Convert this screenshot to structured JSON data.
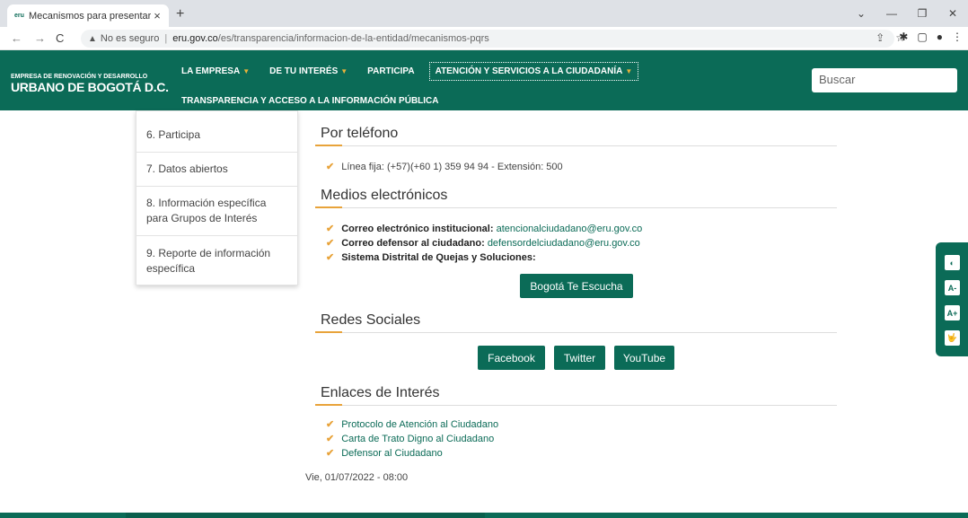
{
  "browser": {
    "tab_title": "Mecanismos para presentar Petic",
    "favicon_text": "eru",
    "back": "←",
    "forward": "→",
    "reload": "C",
    "security_text": "No es seguro",
    "url_host": "eru.gov.co",
    "url_path": "/es/transparencia/informacion-de-la-entidad/mecanismos-pqrs"
  },
  "header": {
    "logo_line1": "EMPRESA DE RENOVACIÓN Y DESARROLLO",
    "logo_line2": "URBANO DE BOGOTÁ D.C.",
    "nav": [
      {
        "label": "LA EMPRESA"
      },
      {
        "label": "DE TU INTERÉS"
      },
      {
        "label": "PARTICIPA"
      },
      {
        "label": "ATENCIÓN Y SERVICIOS A LA CIUDADANÍA"
      }
    ],
    "nav_row2": "TRANSPARENCIA Y ACCESO A LA INFORMACIÓN PÚBLICA",
    "search_placeholder": "Buscar"
  },
  "sidebar": {
    "items": [
      {
        "label": "6. Participa"
      },
      {
        "label": "7. Datos abiertos"
      },
      {
        "label": "8. Información específica para Grupos de Interés"
      },
      {
        "label": "9. Reporte de información específica"
      }
    ]
  },
  "main": {
    "telefono": {
      "title": "Por teléfono",
      "line": "Línea fija: (+57)(+60 1) 359 94 94 - Extensión: 500"
    },
    "medios": {
      "title": "Medios electrónicos",
      "correo_label": "Correo electrónico institucional:",
      "correo_value": "atencionalciudadano@eru.gov.co",
      "defensor_label": "Correo defensor al ciudadano:",
      "defensor_value": "defensordelciudadano@eru.gov.co",
      "sistema_label": "Sistema Distrital de Quejas y Soluciones:",
      "button": "Bogotá Te Escucha"
    },
    "redes": {
      "title": "Redes Sociales",
      "facebook": "Facebook",
      "twitter": "Twitter",
      "youtube": "YouTube"
    },
    "enlaces": {
      "title": "Enlaces de Interés",
      "links": [
        {
          "label": "Protocolo de Atención al Ciudadano"
        },
        {
          "label": "Carta de Trato Digno al Ciudadano"
        },
        {
          "label": "Defensor al Ciudadano"
        }
      ]
    },
    "date": "Vie, 01/07/2022 - 08:00"
  },
  "a11y": {
    "contrast": "◐",
    "decrease": "A-",
    "increase": "A+",
    "sign": "🤟"
  },
  "colors": {
    "brand_green": "#0b6b57",
    "accent_orange": "#e8a33a"
  }
}
